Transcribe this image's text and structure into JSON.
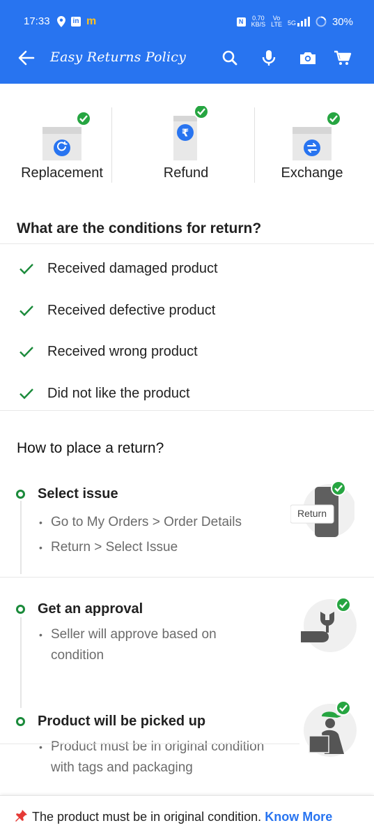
{
  "status_bar": {
    "time": "17:33",
    "speed_value": "0.70",
    "speed_unit": "KB/S",
    "vo": "Vo",
    "lte": "LTE",
    "net": "5G",
    "battery": "30%"
  },
  "app_bar": {
    "title": "Easy Returns Policy"
  },
  "return_types": [
    {
      "label": "Replacement",
      "icon": "replace-icon"
    },
    {
      "label": "Refund",
      "icon": "rupee-icon"
    },
    {
      "label": "Exchange",
      "icon": "exchange-icon"
    }
  ],
  "conditions": {
    "title": "What are the conditions for return?",
    "items": [
      "Received damaged product",
      "Received defective product",
      "Received wrong product",
      "Did not like the product"
    ]
  },
  "how_to": {
    "title": "How to place a return?",
    "steps": [
      {
        "title": "Select issue",
        "bullets": [
          "Go to My Orders > Order Details",
          "Return > Select Issue"
        ],
        "illus_label": "Return"
      },
      {
        "title": "Get an approval",
        "bullets": [
          "Seller will approve based on condition"
        ]
      },
      {
        "title": "Product will be picked up",
        "bullets": [
          "Product must be in original condition with tags and packaging"
        ]
      }
    ]
  },
  "footer": {
    "message": "The product must be in original condition.",
    "link": "Know More"
  },
  "colors": {
    "brand_blue": "#2874f0",
    "check_green": "#1a8a3a",
    "badge_green": "#26a541"
  }
}
